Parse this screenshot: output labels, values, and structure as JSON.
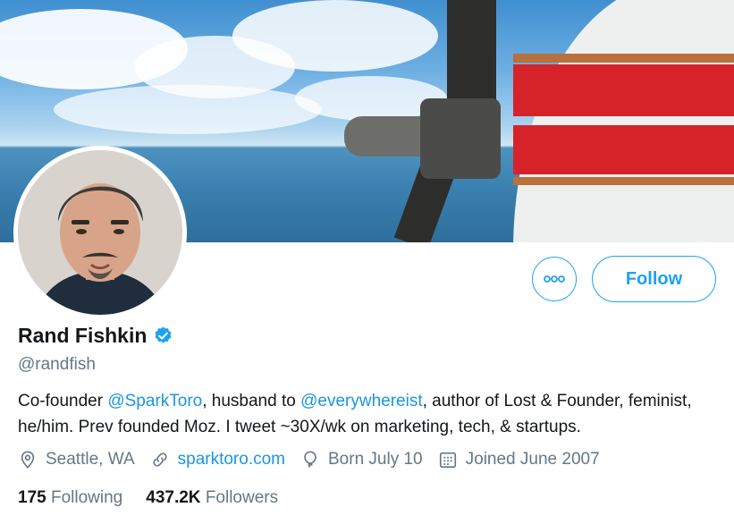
{
  "profile": {
    "name": "Rand Fishkin",
    "handle": "@randfish",
    "verified": true,
    "bio": {
      "part1": "Co-founder ",
      "mention1": "@SparkToro",
      "part2": ", husband to ",
      "mention2": "@everywhereist",
      "part3": ", author of Lost & Founder, feminist, he/him. Prev founded Moz. I tweet ~30X/wk on marketing, tech, & startups."
    },
    "location": "Seattle, WA",
    "website": "sparktoro.com",
    "birthday": "Born July 10",
    "joined": "Joined June 2007"
  },
  "actions": {
    "follow_label": "Follow",
    "more_label": "ooo"
  },
  "stats": {
    "following_count": "175",
    "following_label": "Following",
    "followers_count": "437.2K",
    "followers_label": "Followers"
  },
  "colors": {
    "accent": "#1da1f2",
    "link": "#1b95e0",
    "secondary_text": "#657786",
    "primary_text": "#14171a"
  }
}
